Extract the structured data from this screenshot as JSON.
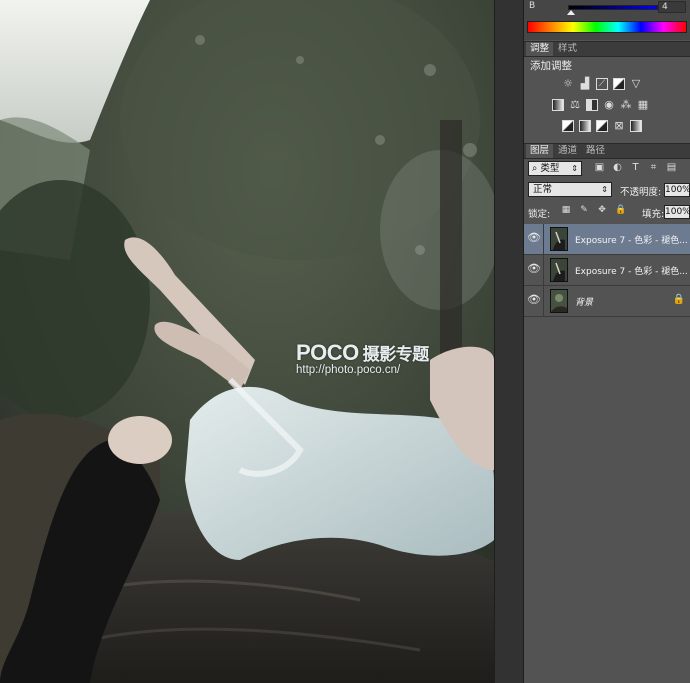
{
  "colors": {
    "panel_bg": "#535353",
    "selected_layer": "#6d7b91",
    "canvas_bg": "#2f352f"
  },
  "color_panel": {
    "channel_label": "B",
    "channel_value": "4"
  },
  "adjustments_panel": {
    "tabs": [
      "调整",
      "样式"
    ],
    "title": "添加调整",
    "icons_row1": [
      "brightness-icon",
      "levels-icon",
      "curves-icon",
      "exposure-icon",
      "vibrance-icon"
    ],
    "icons_row2": [
      "hue-saturation-icon",
      "color-balance-icon",
      "black-white-icon",
      "photo-filter-icon",
      "channel-mixer-icon",
      "color-lookup-icon"
    ],
    "icons_row3": [
      "invert-icon",
      "posterize-icon",
      "threshold-icon",
      "selective-color-icon",
      "gradient-map-icon"
    ]
  },
  "layers_panel": {
    "tabs": [
      "图层",
      "通道",
      "路径"
    ],
    "filter_kind": "类型",
    "blend_mode": "正常",
    "opacity_label": "不透明度:",
    "opacity_value": "100%",
    "lock_label": "锁定:",
    "fill_label": "填充:",
    "fill_value": "100%",
    "layers": [
      {
        "name": "Exposure 7 - 色彩 - 褪色...",
        "selected": true
      },
      {
        "name": "Exposure 7 - 色彩 - 褪色...",
        "selected": false
      },
      {
        "name": "背景",
        "selected": false,
        "locked": true
      }
    ]
  },
  "watermark": {
    "brand": "POCO",
    "subtitle": "摄影专题",
    "url": "http://photo.poco.cn/"
  }
}
